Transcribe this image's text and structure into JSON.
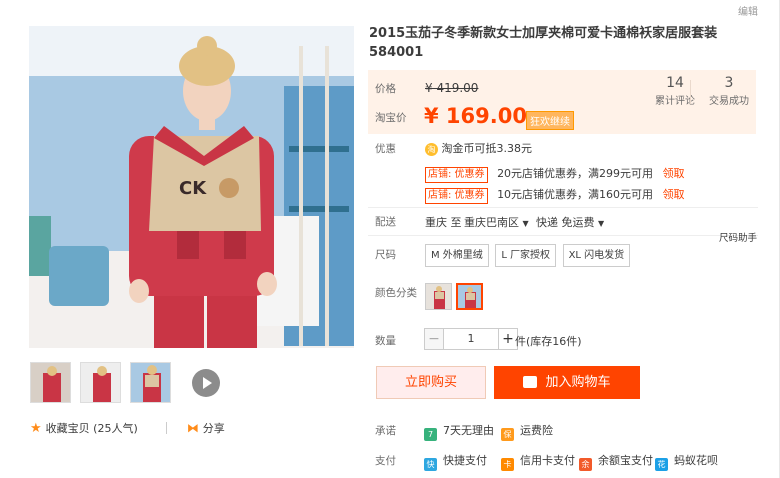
{
  "header": {
    "edit": "编辑"
  },
  "product": {
    "title": "2015玉茄子冬季新款女士加厚夹棉可爱卡通棉袄家居服套装584001"
  },
  "gallery": {
    "thumb_count": 3,
    "favorite_label": "收藏宝贝",
    "favorite_count": "(25人气)",
    "share_label": "分享"
  },
  "price": {
    "price_label": "价格",
    "original": "¥ 419.00",
    "sale_label": "淘宝价",
    "sale": "¥ 169.00",
    "promo_tag": "狂欢继续"
  },
  "stats": {
    "reviews_num": "14",
    "reviews_label": "累计评论",
    "sales_num": "3",
    "sales_label": "交易成功"
  },
  "promo": {
    "label": "优惠",
    "coin_text": "淘金币可抵",
    "coin_value": "3.38元",
    "coupons": [
      {
        "tag": "店铺: 优惠券",
        "text": "20元店铺优惠券，满299元可用",
        "action": "领取"
      },
      {
        "tag": "店铺: 优惠券",
        "text": "10元店铺优惠券，满160元可用",
        "action": "领取"
      }
    ]
  },
  "delivery": {
    "label": "配送",
    "from": "重庆 至",
    "to": "重庆巴南区",
    "shipping": "快递 免运费"
  },
  "size": {
    "label": "尺码",
    "helper": "尺码助手",
    "options": [
      "M 外棉里绒",
      "L 厂家授权",
      "XL 闪电发货"
    ]
  },
  "color": {
    "label": "颜色分类"
  },
  "quantity": {
    "label": "数量",
    "value": "1",
    "stock": "件(库存16件)"
  },
  "actions": {
    "buy_now": "立即购买",
    "add_cart": "加入购物车"
  },
  "promise": {
    "label": "承诺",
    "items": [
      "7天无理由",
      "运费险"
    ]
  },
  "payment": {
    "label": "支付",
    "items": [
      "快捷支付",
      "信用卡支付",
      "余额宝支付",
      "蚂蚁花呗"
    ]
  }
}
